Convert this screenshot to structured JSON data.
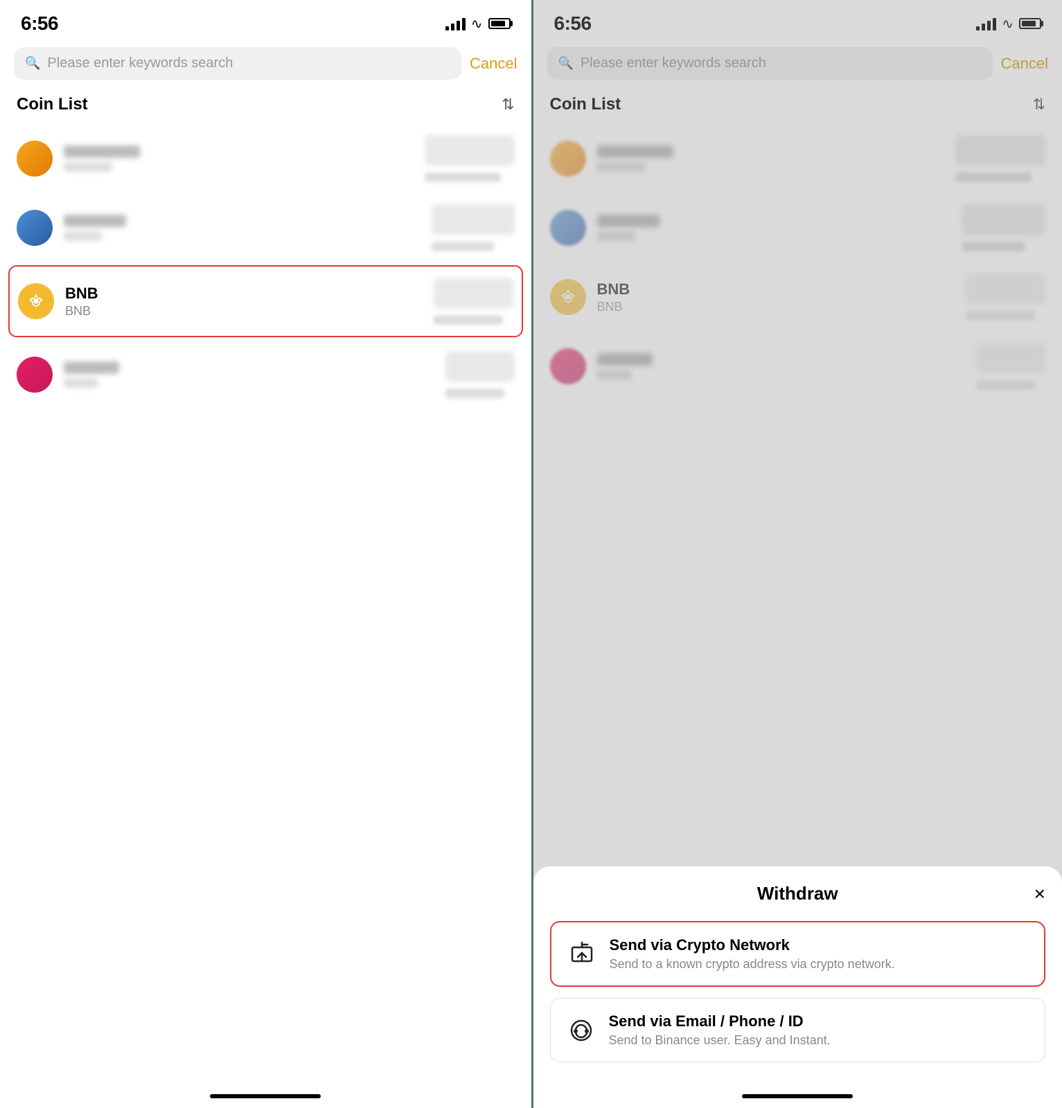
{
  "left_panel": {
    "status": {
      "time": "6:56",
      "signal": "full",
      "wifi": true,
      "battery": "full"
    },
    "search": {
      "placeholder": "Please enter keywords search",
      "cancel_label": "Cancel"
    },
    "coin_list": {
      "title": "Coin List",
      "sort_label": "A-Z sort",
      "coins": [
        {
          "id": "coin1",
          "name": "",
          "symbol": "",
          "color": "orange"
        },
        {
          "id": "coin2",
          "name": "",
          "symbol": "",
          "color": "blue"
        },
        {
          "id": "bnb",
          "name": "BNB",
          "symbol": "BNB",
          "color": "bnb",
          "highlighted": true
        },
        {
          "id": "coin4",
          "name": "",
          "symbol": "",
          "color": "pink"
        }
      ]
    }
  },
  "right_panel": {
    "status": {
      "time": "6:56",
      "signal": "full",
      "wifi": true,
      "battery": "full"
    },
    "search": {
      "placeholder": "Please enter keywords search",
      "cancel_label": "Cancel"
    },
    "coin_list": {
      "title": "Coin List",
      "sort_label": "A-Z sort",
      "coins": [
        {
          "id": "coin1",
          "name": "",
          "symbol": "",
          "color": "orange"
        },
        {
          "id": "coin2",
          "name": "",
          "symbol": "",
          "color": "blue"
        },
        {
          "id": "bnb",
          "name": "BNB",
          "symbol": "BNB",
          "color": "bnb"
        },
        {
          "id": "coin4",
          "name": "",
          "symbol": "",
          "color": "pink"
        }
      ]
    },
    "bottom_sheet": {
      "title": "Withdraw",
      "close_label": "×",
      "options": [
        {
          "id": "crypto",
          "title": "Send via Crypto Network",
          "desc": "Send to a known crypto address via crypto network.",
          "highlighted": true
        },
        {
          "id": "email",
          "title": "Send via Email / Phone / ID",
          "desc": "Send to Binance user. Easy and Instant."
        }
      ]
    }
  }
}
